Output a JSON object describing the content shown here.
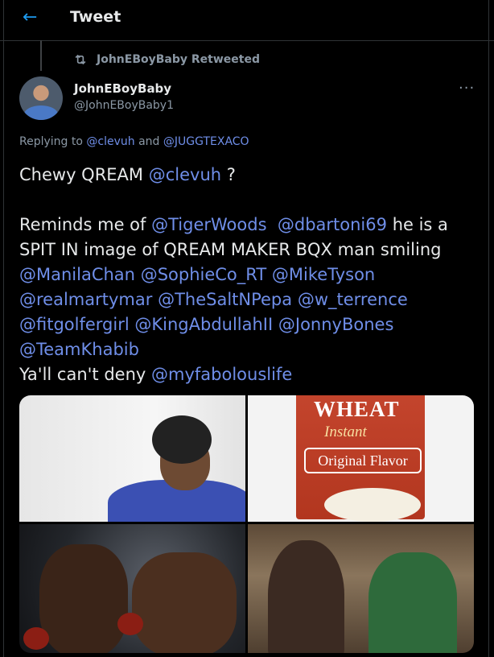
{
  "header": {
    "title": "Tweet",
    "back_icon": "arrow-left-icon"
  },
  "retweet": {
    "text": "JohnEBoyBaby Retweeted",
    "icon": "retweet-icon"
  },
  "author": {
    "name": "JohnEBoyBaby",
    "handle": "@JohnEBoyBaby1"
  },
  "replying": {
    "prefix": "Replying to",
    "user1": "@clevuh",
    "and": "and",
    "user2": "@JUGGTEXACO"
  },
  "tweet": {
    "line1_text": "Chewy QREAM",
    "line1_mention": "@clevuh",
    "line1_end": "?",
    "reminds": "Reminds me of",
    "m_tiger": "@TigerWoods",
    "m_dbartoni": "@dbartoni69",
    "mid_text": "he is a SPIT IN image of QREAM MAKER BQX man smiling",
    "m1": "@ManilaChan",
    "m2": "@SophieCo_RT",
    "m3": "@MikeTyson",
    "m4": "@realmartymar",
    "m5": "@TheSaltNPepa",
    "m6": "@w_terrence",
    "m7": "@fitgolfergirl",
    "m8": "@KingAbdullahII",
    "m9": "@JonnyBones",
    "m10": "@TeamKhabib",
    "last_text": "Ya'll can't deny",
    "last_mention": "@myfabolouslife"
  },
  "media": {
    "box_brand_text": "WHEAT",
    "box_sub_text": "Instant",
    "box_flavor_text": "Original Flavor"
  },
  "colors": {
    "link": "#6f8ee8",
    "accent": "#1d9bf0",
    "muted": "#8b98a5"
  }
}
